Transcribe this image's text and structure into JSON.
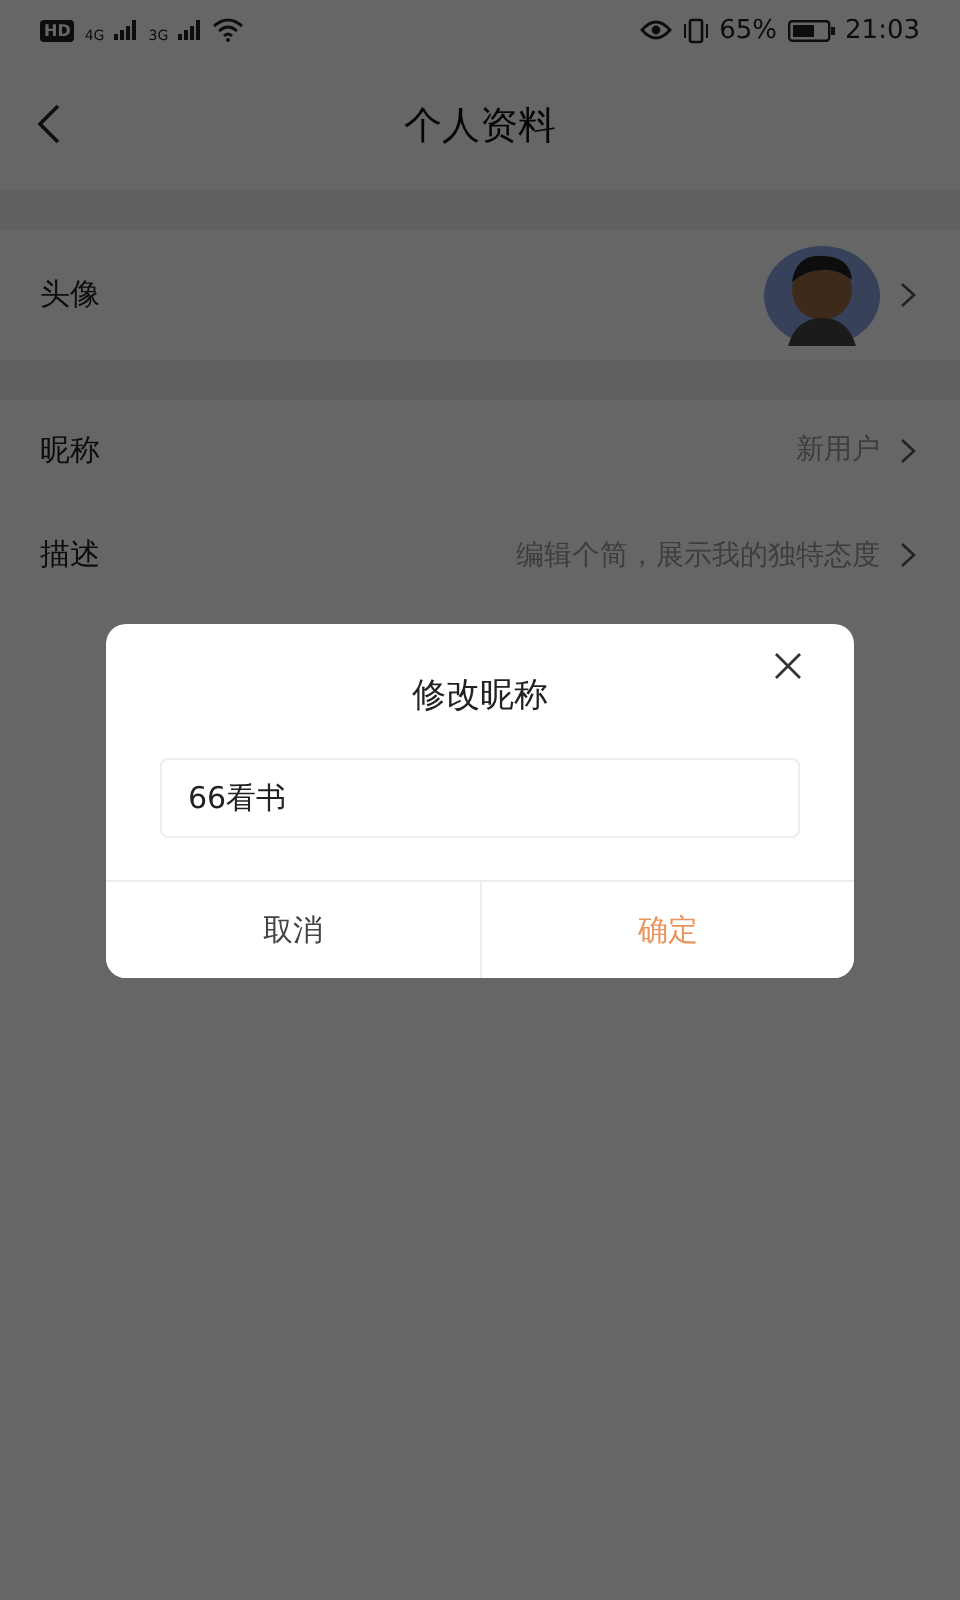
{
  "status_bar": {
    "hd": "HD",
    "network_1": "4G",
    "network_2": "3G",
    "battery": "65%",
    "time": "21:03"
  },
  "header": {
    "title": "个人资料"
  },
  "rows": [
    {
      "kind": "avatar",
      "label": "头像"
    },
    {
      "kind": "text",
      "label": "昵称",
      "value": "新用户"
    },
    {
      "kind": "text",
      "label": "描述",
      "value": "编辑个简，展示我的独特态度"
    }
  ],
  "dialog": {
    "title": "修改昵称",
    "input_value": "66看书",
    "buttons": [
      {
        "label": "取消",
        "primary": false
      },
      {
        "label": "确定",
        "primary": true
      }
    ]
  }
}
